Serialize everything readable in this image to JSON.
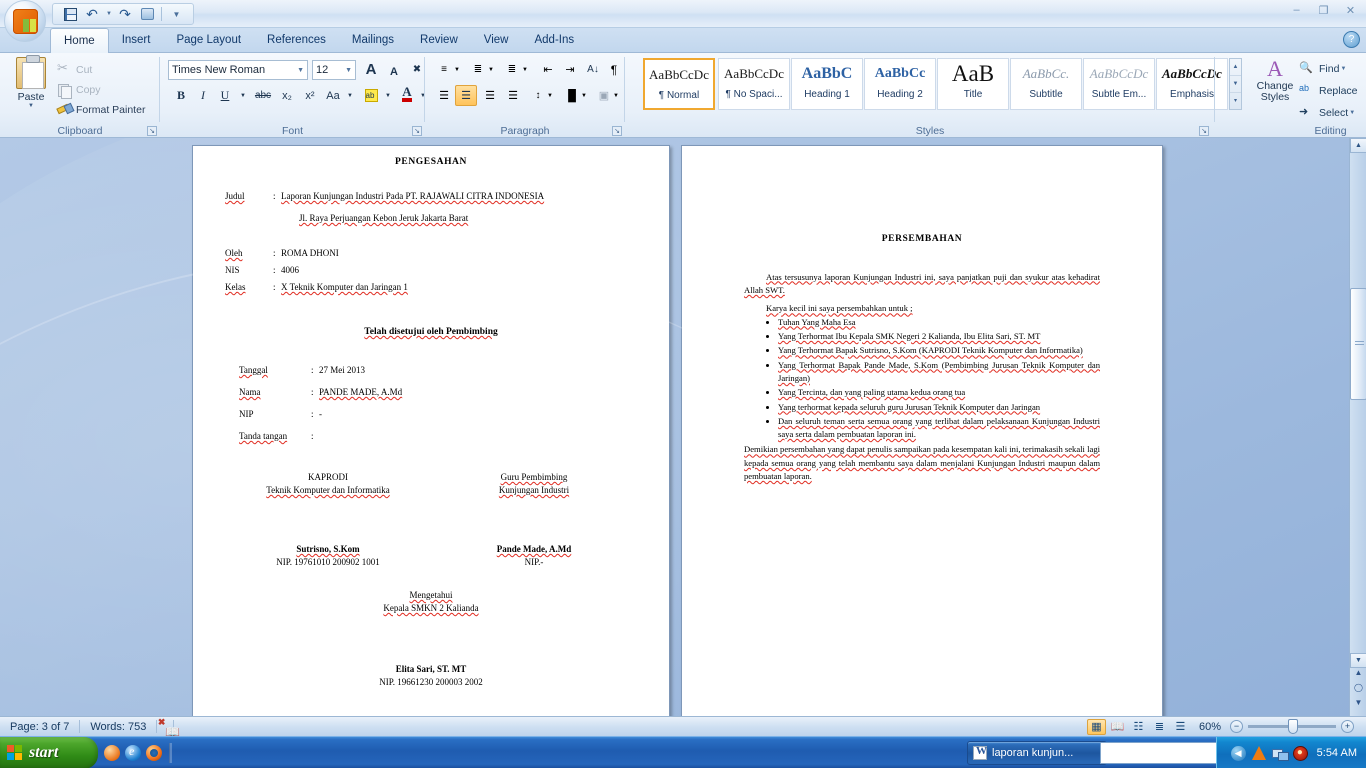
{
  "app": {
    "title": "Microsoft Word",
    "quick_access": [
      "save-icon",
      "undo-icon",
      "redo-icon",
      "print-preview-icon",
      "customize-qat-icon"
    ],
    "window_buttons": {
      "minimize": "–",
      "restore": "❐",
      "close": "✕"
    },
    "help_label": "?"
  },
  "tabs": [
    {
      "label": "Home",
      "active": true
    },
    {
      "label": "Insert",
      "active": false
    },
    {
      "label": "Page Layout",
      "active": false
    },
    {
      "label": "References",
      "active": false
    },
    {
      "label": "Mailings",
      "active": false
    },
    {
      "label": "Review",
      "active": false
    },
    {
      "label": "View",
      "active": false
    },
    {
      "label": "Add-Ins",
      "active": false
    }
  ],
  "ribbon": {
    "clipboard": {
      "group_label": "Clipboard",
      "paste_label": "Paste",
      "cut_label": "Cut",
      "copy_label": "Copy",
      "format_painter_label": "Format Painter"
    },
    "font": {
      "group_label": "Font",
      "font_name": "Times New Roman",
      "font_size": "12",
      "buttons": [
        "grow-font",
        "shrink-font",
        "clear-formatting",
        "bold",
        "italic",
        "underline",
        "strikethrough",
        "subscript",
        "superscript",
        "change-case",
        "text-highlight",
        "font-color"
      ],
      "bold_label": "B",
      "italic_label": "I",
      "underline_label": "U",
      "strike_label": "abc",
      "sub_label": "x₂",
      "sup_label": "x²",
      "case_label": "Aa",
      "grow_label": "A",
      "shrink_label": "A"
    },
    "paragraph": {
      "group_label": "Paragraph",
      "buttons": [
        "bullets",
        "numbering",
        "multilevel-list",
        "decrease-indent",
        "increase-indent",
        "sort",
        "show-formatting-marks",
        "align-left",
        "align-center",
        "align-right",
        "justify",
        "line-spacing",
        "shading",
        "borders"
      ],
      "active_alignment": "align-center",
      "sort_label": "A↓",
      "pilcrow_label": "¶"
    },
    "styles": {
      "group_label": "Styles",
      "items": [
        {
          "preview": "AaBbCcDc",
          "name": "¶ Normal",
          "selected": true
        },
        {
          "preview": "AaBbCcDc",
          "name": "¶ No Spaci...",
          "selected": false
        },
        {
          "preview": "AaBbC",
          "name": "Heading 1",
          "selected": false
        },
        {
          "preview": "AaBbCc",
          "name": "Heading 2",
          "selected": false
        },
        {
          "preview": "AaB",
          "name": "Title",
          "selected": false
        },
        {
          "preview": "AaBbCc.",
          "name": "Subtitle",
          "selected": false
        },
        {
          "preview": "AaBbCcDc",
          "name": "Subtle Em...",
          "selected": false
        },
        {
          "preview": "AaBbCcDc",
          "name": "Emphasis",
          "selected": false
        }
      ],
      "change_styles_label": "Change\nStyles",
      "change_styles_line1": "Change",
      "change_styles_line2": "Styles"
    },
    "editing": {
      "group_label": "Editing",
      "find_label": "Find",
      "replace_label": "Replace",
      "select_label": "Select"
    }
  },
  "document": {
    "page_left": {
      "heading": "PENGESAHAN",
      "fields": [
        {
          "label": "Judul",
          "sep": ":",
          "value": "Laporan Kunjungan Industri  Pada PT. RAJAWALI CITRA INDONESIA"
        },
        {
          "label": "",
          "sep": "",
          "value": "Jl. Raya Perjuangan Kebon Jeruk Jakarta Barat"
        }
      ],
      "identity": [
        {
          "label": "Oleh",
          "sep": ":",
          "value": "ROMA DHONI"
        },
        {
          "label": "NIS",
          "sep": ":",
          "value": "4006"
        },
        {
          "label": "Kelas",
          "sep": ":",
          "value": "X Teknik Komputer dan Jaringan 1"
        }
      ],
      "approval_heading": "Telah disetujui oleh Pembimbing",
      "approval": [
        {
          "label": "Tanggal",
          "sep": ":",
          "value": "27 Mei 2013"
        },
        {
          "label": "Nama",
          "sep": ":",
          "value": "PANDE MADE, A.Md"
        },
        {
          "label": "NIP",
          "sep": ":",
          "value": "-"
        },
        {
          "label": "Tanda tangan",
          "sep": ":",
          "value": ""
        }
      ],
      "signers": [
        {
          "role_line1": "KAPRODI",
          "role_line2": "Teknik Komputer dan Informatika",
          "name": "Sutrisno, S.Kom",
          "nip": "NIP. 19761010 200902 1001"
        },
        {
          "role_line1": "Guru Pembimbing",
          "role_line2": "Kunjungan Industri",
          "name": "Pande Made, A.Md",
          "nip": "NIP.-"
        }
      ],
      "knowing_line1": "Mengetahui",
      "knowing_line2": "Kepala SMKN 2 Kalianda",
      "principal_name": "Elita Sari, ST. MT",
      "principal_nip": "NIP. 19661230 200003 2002"
    },
    "page_right": {
      "heading": "PERSEMBAHAN",
      "para1": "Atas tersusunya laporan Kunjungan Industri ini,  saya panjatkan puji dan syukur atas kehadirat Allah SWT.",
      "para2": "Karya kecil ini saya persembahkan untuk ;",
      "bullets": [
        "Tuhan Yang Maha Esa",
        "Yang Terhormat Ibu Kepala SMK Negeri 2 Kalianda, Ibu Elita Sari, ST. MT",
        "Yang Terhormat Bapak Sutrisno, S.Kom (KAPRODI Teknik Komputer dan Informatika)",
        "Yang Terhormat Bapak Pande Made, S.Kom (Pembimbing Jurusan Teknik Komputer dan Jaringan)",
        "Yang Tercinta, dan yang paling utama kedua orang tua",
        "Yang terhormat kepada seluruh guru Jurusan Teknik Komputer dan Jaringan",
        "Dan seluruh teman serta semua orang yang  terlibat dalam pelaksanaan Kunjungan Industri saya serta dalam pembuatan laporan ini."
      ],
      "para3": "Demikian persembahan yang dapat penulis sampaikan pada kesempatan kali ini,  terimakasih sekali  lagi  kepada  semua  orang  yang  telah  membantu  saya  dalam  menjalani  Kunjungan Industri maupun dalam pembuatan laporan."
    }
  },
  "statusbar": {
    "page_info": "Page: 3 of 7",
    "word_count": "Words: 753",
    "proofing_icon": "proofing-errors-icon",
    "view_buttons": [
      "print-layout",
      "full-screen-reading",
      "web-layout",
      "outline",
      "draft"
    ],
    "active_view": "print-layout",
    "zoom_level": "60%",
    "zoom_out_label": "−",
    "zoom_in_label": "+"
  },
  "taskbar": {
    "start_label": "start",
    "quick_launch": [
      "show-desktop-icon",
      "internet-explorer-icon",
      "firefox-icon"
    ],
    "tasks": [
      {
        "label": "laporan kunjun...",
        "icon": "word-document-icon",
        "active": true
      }
    ],
    "tray": [
      "show-hidden-icons",
      "vlc-icon",
      "network-icon",
      "avira-icon"
    ],
    "clock": "5:54 AM"
  }
}
